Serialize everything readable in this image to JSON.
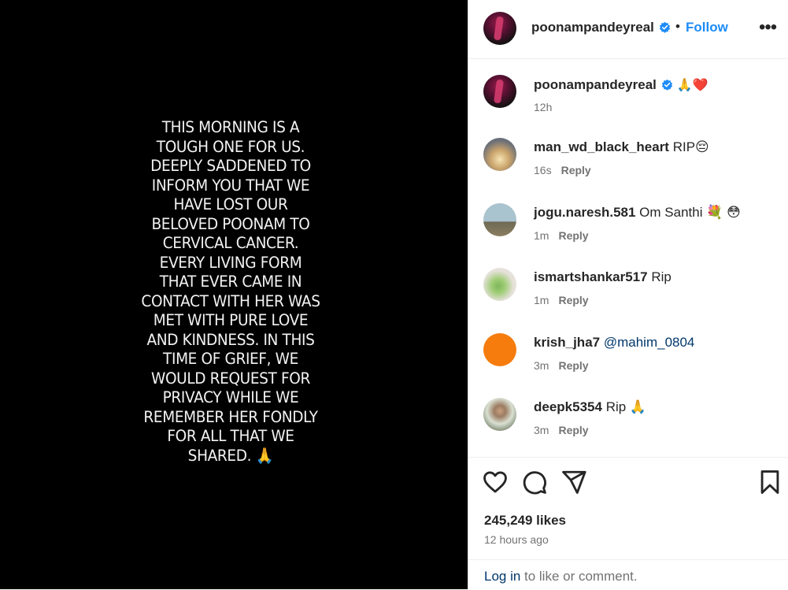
{
  "post": {
    "story_text": "THIS MORNING IS A\nTOUGH ONE FOR US.\nDEEPLY SADDENED TO\nINFORM YOU THAT WE\nHAVE LOST OUR\nBELOVED POONAM TO\nCERVICAL CANCER.\nEVERY LIVING FORM\nTHAT EVER CAME IN\nCONTACT WITH HER WAS\nMET WITH PURE LOVE\nAND KINDNESS. IN THIS\nTIME OF GRIEF, WE\nWOULD REQUEST FOR\nPRIVACY WHILE WE\nREMEMBER HER FONDLY\nFOR ALL THAT WE\nSHARED. 🙏"
  },
  "header": {
    "username": "poonampandeyreal",
    "separator": "•",
    "follow_label": "Follow",
    "more_label": "•••"
  },
  "caption": {
    "username": "poonampandeyreal",
    "text": "🙏❤️",
    "time": "12h"
  },
  "comments": [
    {
      "username": "man_wd_black_heart",
      "text": "RIP😔",
      "time": "16s",
      "reply_label": "Reply",
      "avatar_color": "#c9a06a"
    },
    {
      "username": "jogu.naresh.581",
      "text": "Om Santhi 💐 😳",
      "time": "1m",
      "reply_label": "Reply",
      "avatar_color": "#8aa0a8"
    },
    {
      "username": "ismartshankar517",
      "text": "Rip",
      "time": "1m",
      "reply_label": "Reply",
      "avatar_color": "#c8c0b4"
    },
    {
      "username": "krish_jha7",
      "text": "@mahim_0804",
      "time": "3m",
      "reply_label": "Reply",
      "avatar_color": "#f57c0d"
    },
    {
      "username": "deepk5354",
      "text": "Rip 🙏",
      "time": "3m",
      "reply_label": "Reply",
      "avatar_color": "#9aa58f"
    }
  ],
  "engagement": {
    "likes": "245,249 likes",
    "time_ago": "12 hours ago",
    "login_link": "Log in",
    "login_rest": "to like or comment."
  },
  "colors": {
    "follow_blue": "#1d8cf8",
    "verified_blue": "#1d8cf8"
  }
}
